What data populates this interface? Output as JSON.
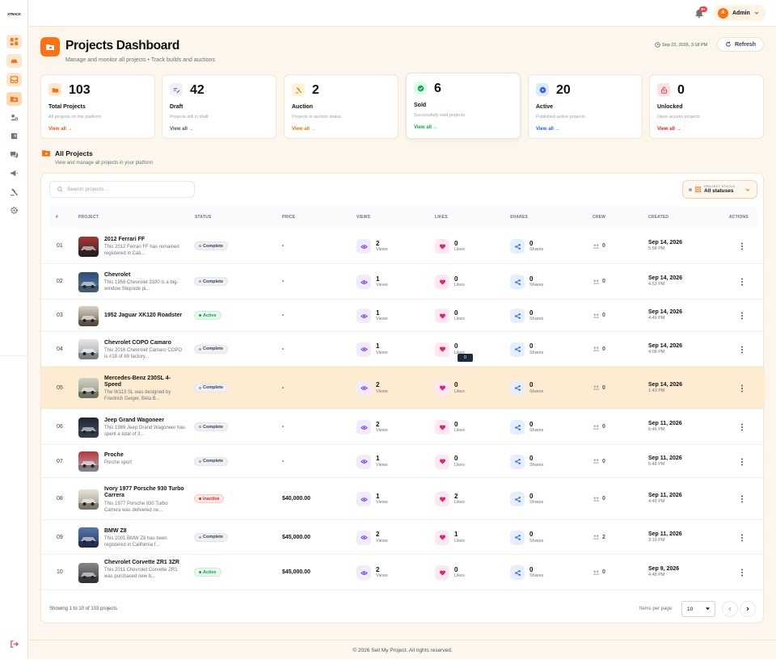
{
  "app": {
    "logo_text": "XTRACK"
  },
  "header": {
    "notification_count": "9+",
    "user_initial": "A",
    "user_name": "Admin"
  },
  "page": {
    "title": "Projects Dashboard",
    "subtitle": "Manage and monitor all projects • Track builds and auctions",
    "datetime": "Sep 22, 2026, 3:18 PM",
    "refresh_label": "Refresh"
  },
  "stats": [
    {
      "value": "103",
      "label": "Total Projects",
      "desc": "All projects on the platform",
      "link": "View all →",
      "color": "#ea580c"
    },
    {
      "value": "42",
      "label": "Draft",
      "desc": "Projects still in draft",
      "link": "View all →",
      "color": "#4b5563"
    },
    {
      "value": "2",
      "label": "Auction",
      "desc": "Projects in auction status",
      "link": "View all →",
      "color": "#d97706"
    },
    {
      "value": "6",
      "label": "Sold",
      "desc": "Successfully sold projects",
      "link": "View all →",
      "color": "#16a34a"
    },
    {
      "value": "20",
      "label": "Active",
      "desc": "Published active projects",
      "link": "View all →",
      "color": "#2563eb"
    },
    {
      "value": "0",
      "label": "Unlocked",
      "desc": "Open access projects",
      "link": "View all →",
      "color": "#dc2626"
    }
  ],
  "section": {
    "title": "All Projects",
    "subtitle": "View and manage all projects in your platform"
  },
  "search": {
    "placeholder": "Search projects..."
  },
  "filter": {
    "label": "PROJECT STATUS",
    "value": "All statuses"
  },
  "table": {
    "headers": [
      "#",
      "PROJECT",
      "STATUS",
      "PRICE",
      "VIEWS",
      "LIKES",
      "SHARES",
      "CREW",
      "CREATED",
      "ACTIONS"
    ],
    "views_unit": "Views",
    "likes_unit": "Likes",
    "shares_unit": "Shares",
    "rows": [
      {
        "num": "01",
        "name": "2012 Ferrari FF",
        "desc": "This 2012 Ferrari FF has remained registered in Cali...",
        "status": "Complete",
        "price": "-",
        "views": "2",
        "likes": "0",
        "shares": "0",
        "crew": "0",
        "date": "Sep 14, 2026",
        "time": "5:58 PM"
      },
      {
        "num": "02",
        "name": "Chevrolet",
        "desc": "This 1956 Chevrolet 3100 is a big-window Stepside pi...",
        "status": "Complete",
        "price": "-",
        "views": "1",
        "likes": "0",
        "shares": "0",
        "crew": "0",
        "date": "Sep 14, 2026",
        "time": "4:53 PM"
      },
      {
        "num": "03",
        "name": "1952 Jaguar XK120 Roadster",
        "desc": "",
        "status": "Active",
        "price": "-",
        "views": "1",
        "likes": "0",
        "shares": "0",
        "crew": "0",
        "date": "Sep 14, 2026",
        "time": "4:49 PM"
      },
      {
        "num": "04",
        "name": "Chevrolet COPO Camaro",
        "desc": "This 2016 Chevrolet Camaro COPO is #18 of 69 factory...",
        "status": "Complete",
        "price": "-",
        "views": "1",
        "likes": "0",
        "shares": "0",
        "crew": "0",
        "date": "Sep 14, 2026",
        "time": "4:08 PM"
      },
      {
        "num": "05",
        "name": "Mercedes-Benz 230SL 4-Speed",
        "desc": "The W113 SL was designed by Friedrich Geiger, Béla B...",
        "status": "Complete",
        "price": "-",
        "views": "2",
        "likes": "0",
        "shares": "0",
        "crew": "0",
        "date": "Sep 14, 2026",
        "time": "1:43 PM"
      },
      {
        "num": "06",
        "name": "Jeep Grand Wagoneer",
        "desc": "This 1989 Jeep Grand Wagoneer has spent a total of 3...",
        "status": "Complete",
        "price": "-",
        "views": "2",
        "likes": "0",
        "shares": "0",
        "crew": "0",
        "date": "Sep 11, 2026",
        "time": "6:46 PM"
      },
      {
        "num": "07",
        "name": "Proche",
        "desc": "Porche sport",
        "status": "Complete",
        "price": "-",
        "views": "1",
        "likes": "0",
        "shares": "0",
        "crew": "0",
        "date": "Sep 11, 2026",
        "time": "5:48 PM"
      },
      {
        "num": "08",
        "name": "Ivory 1977 Porsche 930 Turbo Carrera",
        "desc": "This 1977 Porsche 930 Turbo Carrera was delivered ne...",
        "status": "Inactive",
        "price": "$40,000.00",
        "views": "1",
        "likes": "2",
        "shares": "0",
        "crew": "0",
        "date": "Sep 11, 2026",
        "time": "4:45 PM"
      },
      {
        "num": "09",
        "name": "BMW Z8",
        "desc": "This 2001 BMW Z8 has been registered in California f...",
        "status": "Complete",
        "price": "$45,000.00",
        "views": "2",
        "likes": "1",
        "shares": "0",
        "crew": "2",
        "date": "Sep 11, 2026",
        "time": "3:19 PM"
      },
      {
        "num": "10",
        "name": "Chevrolet Corvette ZR1 3ZR",
        "desc": "This 2011 Chevrolet Corvette ZR1 was purchased new b...",
        "status": "Active",
        "price": "$45,000.00",
        "views": "2",
        "likes": "0",
        "shares": "0",
        "crew": "0",
        "date": "Sep 9, 2026",
        "time": "4:48 PM"
      }
    ]
  },
  "tooltip": {
    "text": "0"
  },
  "pagination": {
    "info": "Showing 1 to 10 of 103 projects",
    "items_per_page_label": "Items per page:",
    "items_per_page": "10"
  },
  "footer": {
    "copyright": "© 2026 Sell My Project. All rights reserved."
  }
}
